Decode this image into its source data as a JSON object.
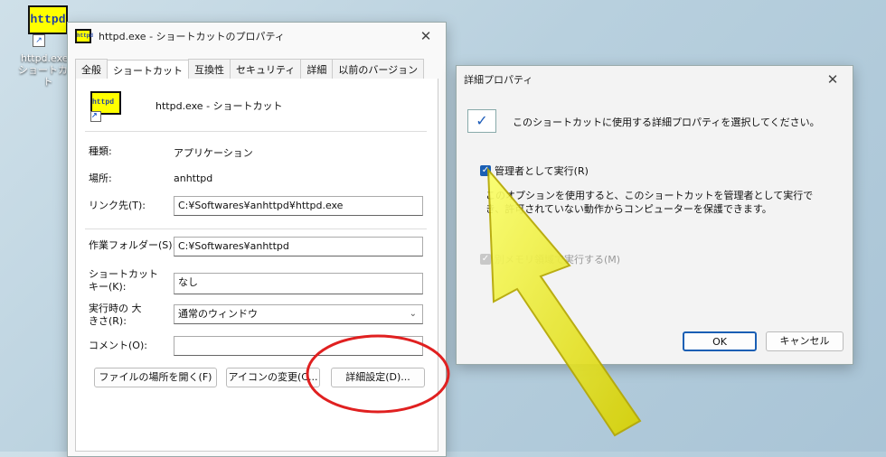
{
  "desktop": {
    "icon_logo": "httpd",
    "icon_label": "httpd.exe - ショートカット"
  },
  "props": {
    "title": "httpd.exe - ショートカットのプロパティ",
    "tabs": [
      "全般",
      "ショートカット",
      "互換性",
      "セキュリティ",
      "詳細",
      "以前のバージョン"
    ],
    "shortcut_name": "httpd.exe - ショートカット",
    "type_label": "種類:",
    "type_value": "アプリケーション",
    "location_label": "場所:",
    "location_value": "anhttpd",
    "target_label": "リンク先(T):",
    "target_value": "C:¥Softwares¥anhttpd¥httpd.exe",
    "startin_label": "作業フォルダー(S):",
    "startin_value": "C:¥Softwares¥anhttpd",
    "hotkey_label": "ショートカット キー(K):",
    "hotkey_value": "なし",
    "run_label": "実行時の 大きさ(R):",
    "run_value": "通常のウィンドウ",
    "comment_label": "コメント(O):",
    "comment_value": "",
    "btn_open_location": "ファイルの場所を開く(F)",
    "btn_change_icon": "アイコンの変更(C...",
    "btn_advanced": "詳細設定(D)..."
  },
  "adv": {
    "title": "詳細プロパティ",
    "intro": "このショートカットに使用する詳細プロパティを選択してください。",
    "run_as_admin": "管理者として実行(R)",
    "admin_desc": "このオプションを使用すると、このショートカットを管理者として実行でき、許可されていない動作からコンピューターを保護できます。",
    "separate_memory": "別メモリ領域で実行する(M)",
    "ok": "OK",
    "cancel": "キャンセル"
  }
}
